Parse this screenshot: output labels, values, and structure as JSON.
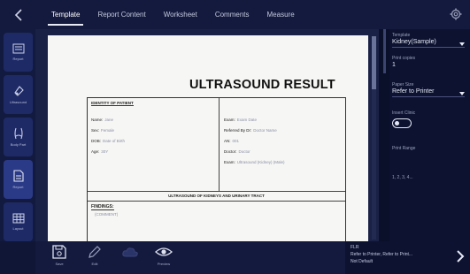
{
  "tabs": [
    {
      "label": "Template",
      "active": true
    },
    {
      "label": "Report Content",
      "active": false
    },
    {
      "label": "Worksheet",
      "active": false
    },
    {
      "label": "Comments",
      "active": false
    },
    {
      "label": "Measure",
      "active": false
    }
  ],
  "left_rail": [
    {
      "icon": "report-icon",
      "label": "Report"
    },
    {
      "icon": "transducer-icon",
      "label": "Ultrasound"
    },
    {
      "icon": "body-part-icon",
      "label": "Body Part"
    },
    {
      "icon": "document-icon",
      "label": "Report",
      "active": true
    },
    {
      "icon": "grid-icon",
      "label": "Layout"
    }
  ],
  "document": {
    "title": "ULTRASOUND RESULT",
    "patient_section": "IDENTITY OF PATIENT",
    "fields_left": [
      {
        "label": "Name:",
        "value": "Jane"
      },
      {
        "label": "Sex:",
        "value": "Female"
      },
      {
        "label": "DOB:",
        "value": "Date of Birth"
      },
      {
        "label": "Age:",
        "value": "30Y"
      }
    ],
    "fields_right": [
      {
        "label": "Exam:",
        "value": "Exam Date"
      },
      {
        "label": "Referred By Dr:",
        "value": "Doctor Name"
      },
      {
        "label": "AN:",
        "value": "001"
      },
      {
        "label": "Doctor:",
        "value": "Doctor"
      },
      {
        "label": "Exam:",
        "value": "Ultrasound (Kidney) (Male)"
      }
    ],
    "exam_section": "ULTRASOUND OF KIDNEYS AND URINARY TRACT",
    "findings_label": "FINDINGS:",
    "findings_value": "(COMMENT)"
  },
  "right_panel": {
    "template_label": "Template",
    "template_value": "Kidney(Sample)",
    "print_copies_label": "Print copies",
    "print_copies_value": "1",
    "paper_size_label": "Paper Size",
    "paper_size_value": "Refer to Printer",
    "insert_clinic_label": "Insert Clinic",
    "insert_clinic_on": false,
    "print_range_label": "Print Range",
    "print_range_value": "1, 2, 3, 4..."
  },
  "bottom_bar": {
    "buttons": [
      {
        "icon": "save-icon",
        "label": "Save"
      },
      {
        "icon": "pen-icon",
        "label": "Edit"
      },
      {
        "icon": "cloud-icon",
        "label": ""
      },
      {
        "icon": "eye-icon",
        "label": "Preview"
      }
    ],
    "info_title": "FLR",
    "info_line1": "Refer to Printer, Refer to Print...",
    "info_line2": "Not Default"
  }
}
